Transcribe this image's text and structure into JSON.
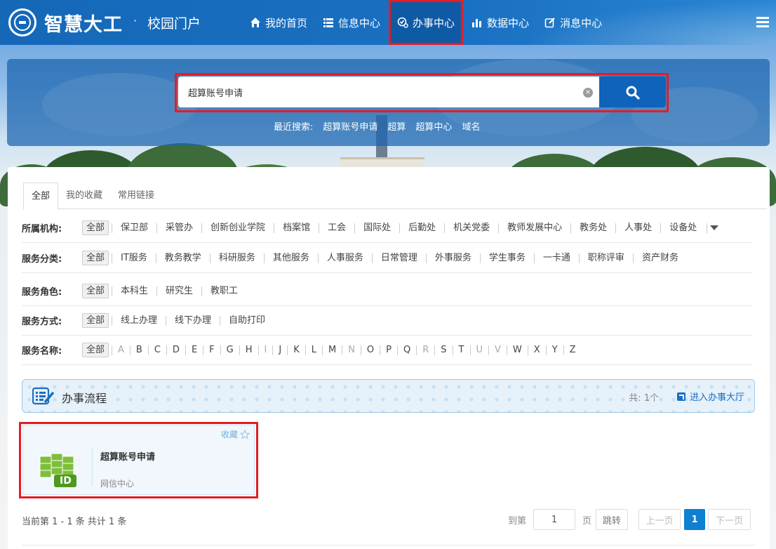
{
  "header": {
    "title": "智慧大工",
    "dot": "·",
    "subtitle": "校园门户",
    "nav": [
      {
        "label": "我的首页",
        "icon": "home-icon"
      },
      {
        "label": "信息中心",
        "icon": "list-icon"
      },
      {
        "label": "办事中心",
        "icon": "service-icon",
        "active": true
      },
      {
        "label": "数据中心",
        "icon": "bar-chart-icon"
      },
      {
        "label": "消息中心",
        "icon": "edit-icon"
      }
    ]
  },
  "search": {
    "value": "超算账号申请",
    "recent_label": "最近搜索:",
    "recent": [
      "超算账号申请",
      "超算",
      "超算中心",
      "域名"
    ]
  },
  "tabs": [
    "全部",
    "我的收藏",
    "常用链接"
  ],
  "filters": [
    {
      "label": "所属机构:",
      "all": "全部",
      "options": [
        "保卫部",
        "采管办",
        "创新创业学院",
        "档案馆",
        "工会",
        "国际处",
        "后勤处",
        "机关党委",
        "教师发展中心",
        "教务处",
        "人事处",
        "设备处"
      ],
      "more": true
    },
    {
      "label": "服务分类:",
      "all": "全部",
      "options": [
        "IT服务",
        "教务教学",
        "科研服务",
        "其他服务",
        "人事服务",
        "日常管理",
        "外事服务",
        "学生事务",
        "一卡通",
        "职称评审",
        "资产财务"
      ]
    },
    {
      "label": "服务角色:",
      "all": "全部",
      "options": [
        "本科生",
        "研究生",
        "教职工"
      ]
    },
    {
      "label": "服务方式:",
      "all": "全部",
      "options": [
        "线上办理",
        "线下办理",
        "自助打印"
      ]
    },
    {
      "label": "服务名称:",
      "all": "全部",
      "options": [
        "A",
        "B",
        "C",
        "D",
        "E",
        "F",
        "G",
        "H",
        "I",
        "J",
        "K",
        "L",
        "M",
        "N",
        "O",
        "P",
        "Q",
        "R",
        "S",
        "T",
        "U",
        "V",
        "W",
        "X",
        "Y",
        "Z"
      ],
      "disabled": [
        "A",
        "I",
        "N",
        "R",
        "U",
        "V"
      ]
    }
  ],
  "section": {
    "title": "办事流程",
    "count": "共: 1个",
    "link": "进入办事大厅"
  },
  "card": {
    "fav": "收藏",
    "name": "超算账号申请",
    "dept": "网信中心",
    "badge": "ID"
  },
  "pager": {
    "info": "当前第 1 - 1 条 共计 1 条",
    "goto": "到第",
    "page_input": "1",
    "page_unit": "页",
    "jump": "跳转",
    "prev": "上一页",
    "current": "1",
    "next": "下一页"
  },
  "colors": {
    "brand": "#1568b8",
    "highlight": "#e51c24",
    "accent": "#0f7fd1"
  }
}
